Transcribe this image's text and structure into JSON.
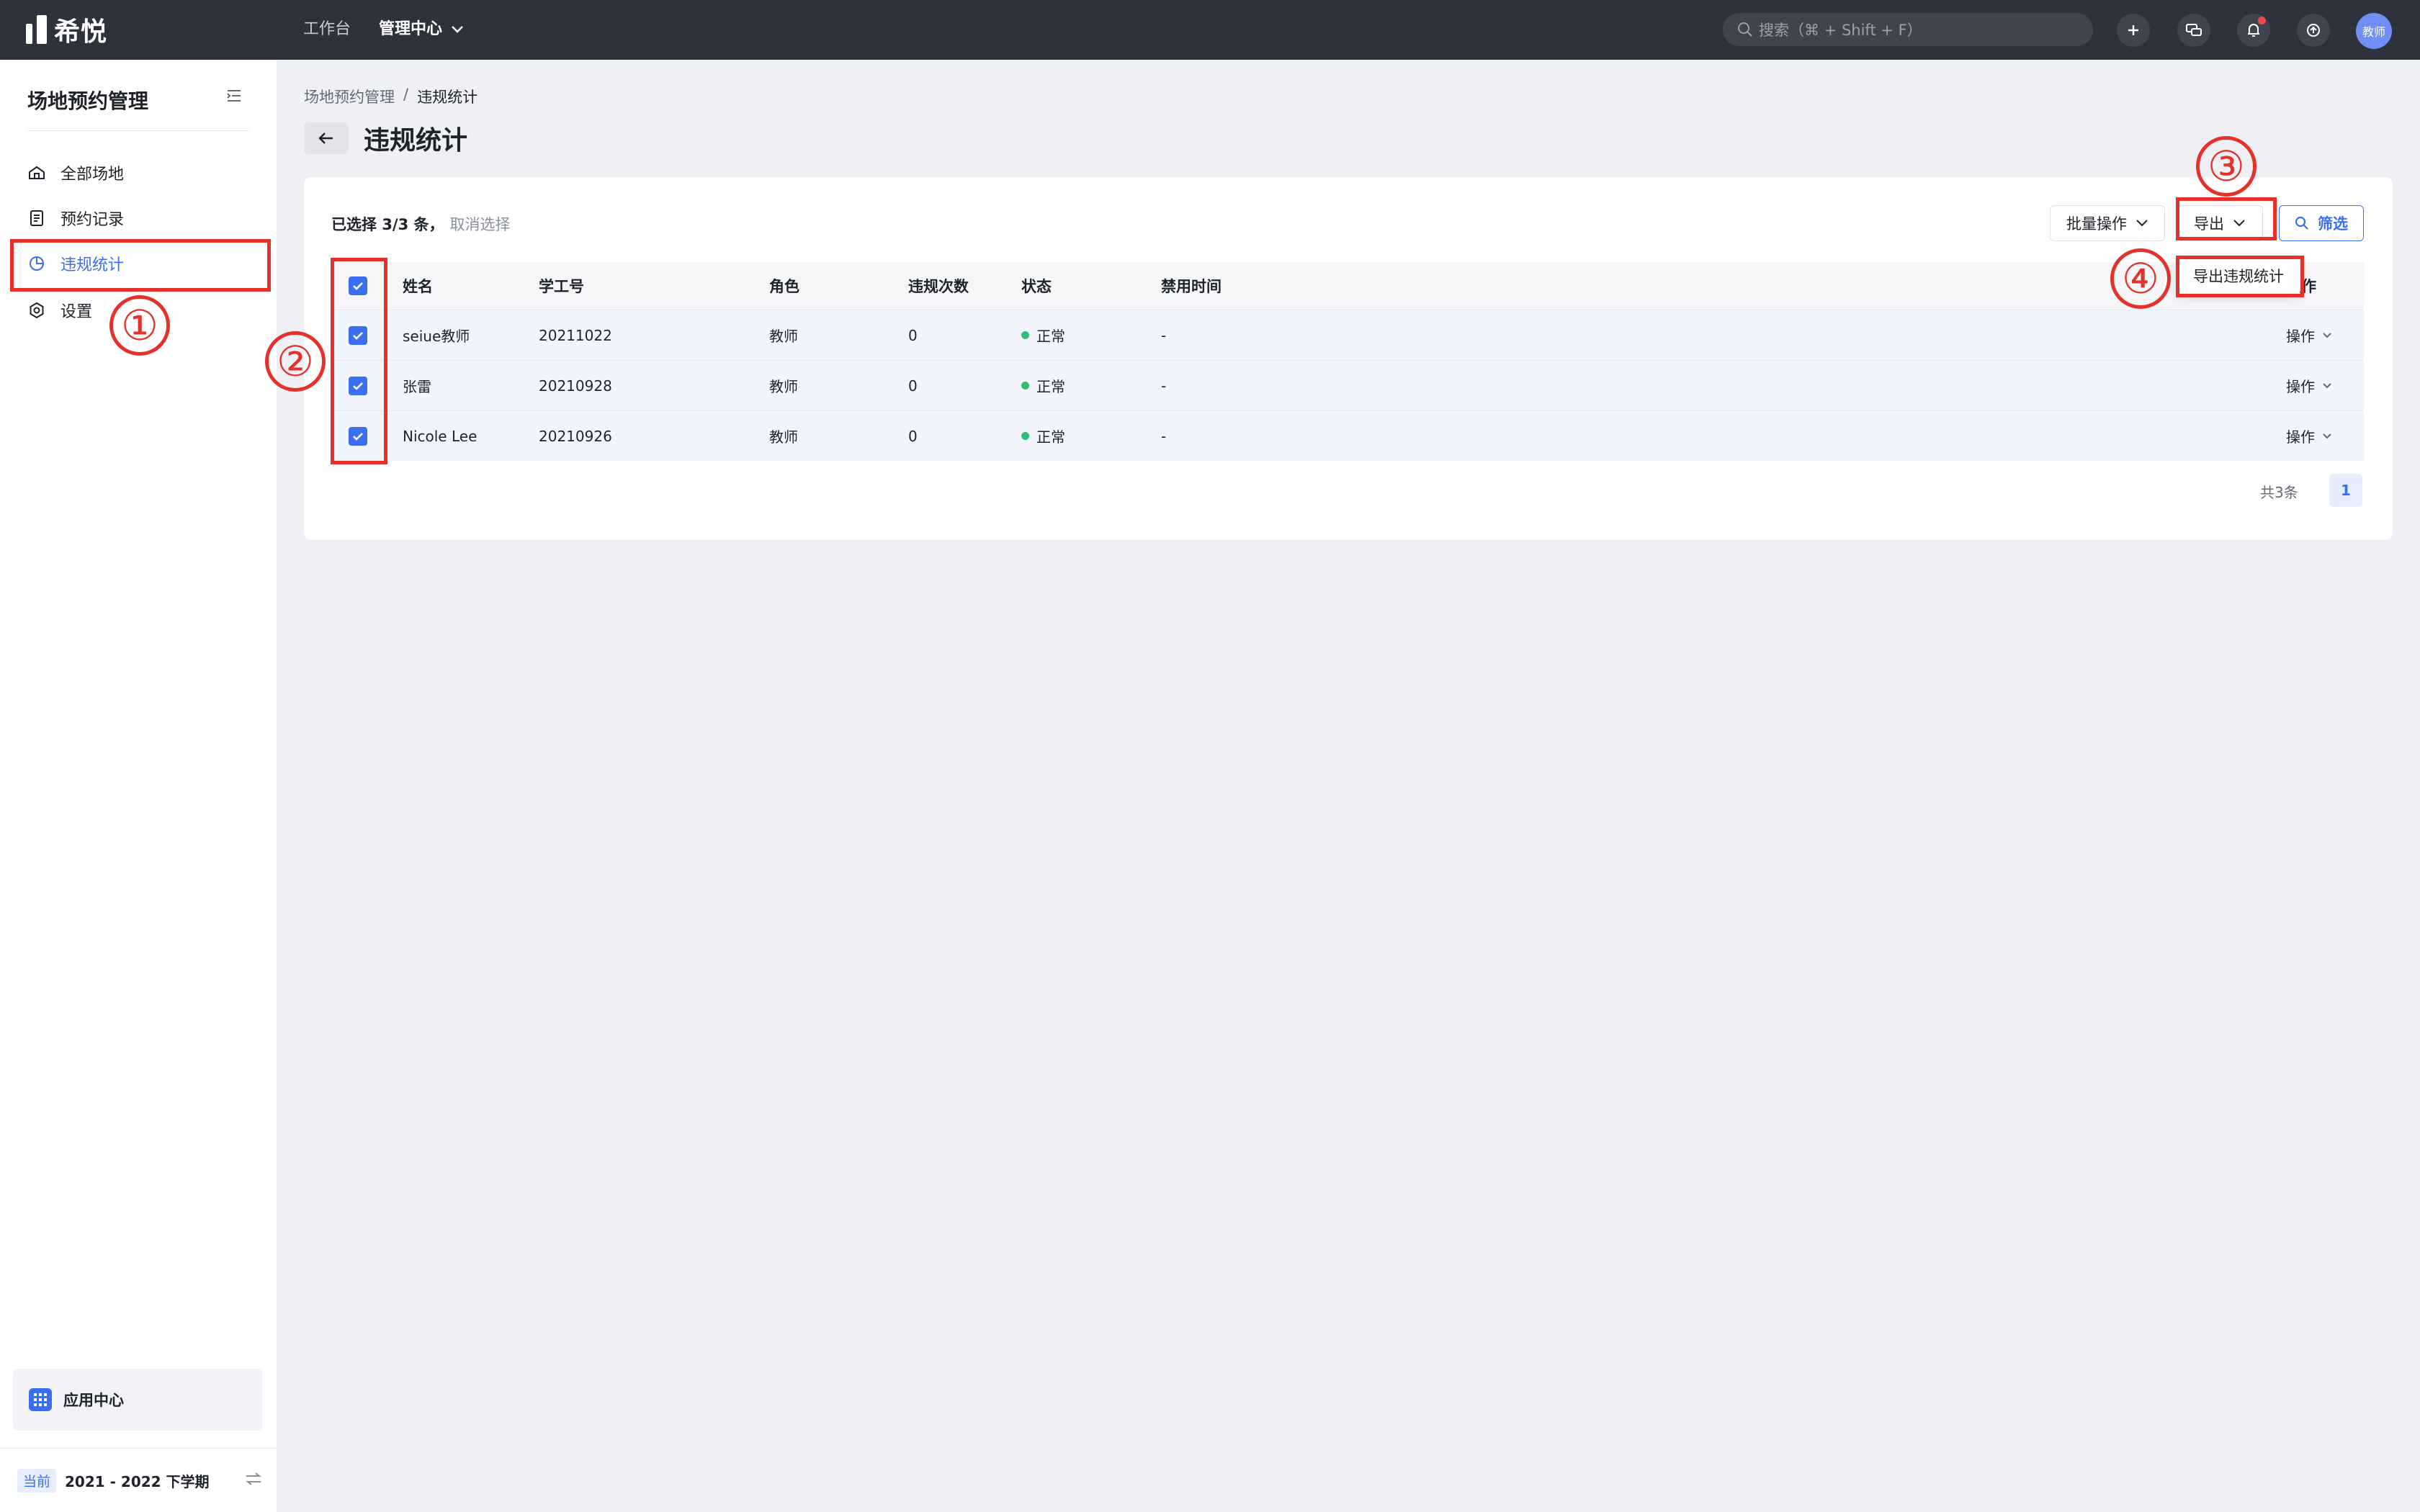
{
  "topbar": {
    "brand": "希悦",
    "nav_workbench": "工作台",
    "nav_admin": "管理中心",
    "search_placeholder": "搜索（⌘ + Shift + F）",
    "avatar_text": "教师"
  },
  "sidebar": {
    "title": "场地预约管理",
    "items": [
      {
        "label": "全部场地",
        "icon": "venue-icon"
      },
      {
        "label": "预约记录",
        "icon": "record-icon"
      },
      {
        "label": "违规统计",
        "icon": "pie-chart-icon",
        "active": true
      },
      {
        "label": "设置",
        "icon": "gear-icon"
      }
    ],
    "app_center": "应用中心",
    "term_badge": "当前",
    "term": "2021 - 2022 下学期"
  },
  "breadcrumb": {
    "parent": "场地预约管理",
    "separator": "/",
    "current": "违规统计"
  },
  "page_title": "违规统计",
  "toolbar": {
    "selected_prefix": "已选择 3/3 条，",
    "cancel_selection": "取消选择",
    "batch_ops": "批量操作",
    "export": "导出",
    "filter": "筛选"
  },
  "export_menu": {
    "item": "导出违规统计"
  },
  "table": {
    "headers": {
      "name": "姓名",
      "id": "学工号",
      "role": "角色",
      "count": "违规次数",
      "status": "状态",
      "ban": "禁用时间",
      "op": "操作"
    },
    "rows": [
      {
        "name": "seiue教师",
        "id": "20211022",
        "role": "教师",
        "count": "0",
        "status": "正常",
        "ban": "-",
        "op": "操作"
      },
      {
        "name": "张雷",
        "id": "20210928",
        "role": "教师",
        "count": "0",
        "status": "正常",
        "ban": "-",
        "op": "操作"
      },
      {
        "name": "Nicole Lee",
        "id": "20210926",
        "role": "教师",
        "count": "0",
        "status": "正常",
        "ban": "-",
        "op": "操作"
      }
    ]
  },
  "pagination": {
    "total": "共3条",
    "page": "1"
  },
  "annotations": {
    "n1": "①",
    "n2": "②",
    "n3": "③",
    "n4": "④"
  },
  "colors": {
    "accent": "#3a6ff2",
    "annotation": "#e4322b",
    "status_ok": "#2fbf71",
    "topbar": "#2e323c"
  }
}
